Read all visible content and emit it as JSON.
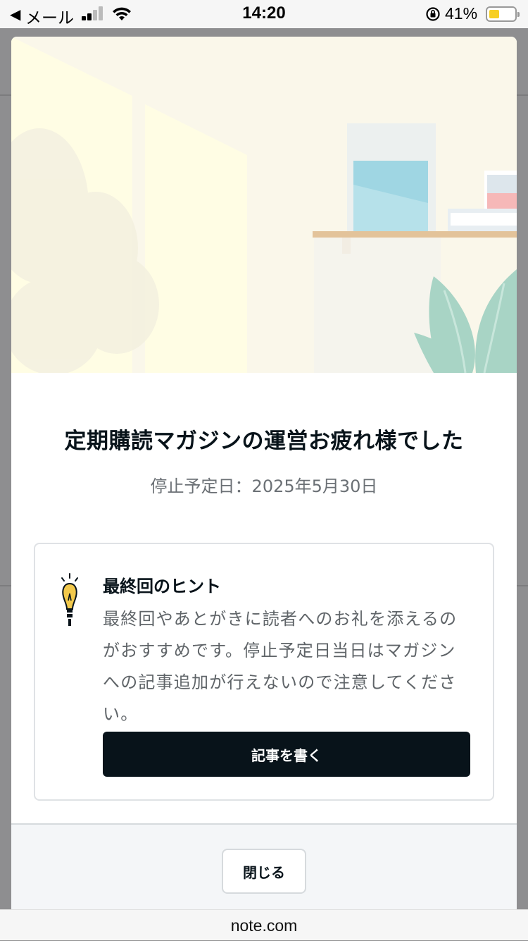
{
  "status_bar": {
    "back_arrow": "◀",
    "app": "メール",
    "time": "14:20",
    "battery_percent": "41%",
    "battery_level": 0.41,
    "battery_color": "#f7cf23",
    "icons": [
      "signal-icon",
      "wifi-icon",
      "rotation-lock-icon",
      "battery-icon"
    ]
  },
  "modal": {
    "title": "定期購読マガジンの運営お疲れ様でした",
    "stop_date": "停止予定日：2025年5月30日",
    "hint": {
      "icon": "lightbulb-icon",
      "title": "最終回のヒント",
      "body": "最終回やあとがきに読者へのお礼を添えるのがおすすめです。停止予定日当日はマガジンへの記事追加が行えないので注意してください。",
      "button_label": "記事を書く"
    },
    "close_label": "閉じる"
  },
  "browser": {
    "url": "note.com"
  },
  "colors": {
    "primary_button": "#08131a",
    "accent_bulb": "#f2c94c",
    "hero_background": "#faf7ea"
  }
}
